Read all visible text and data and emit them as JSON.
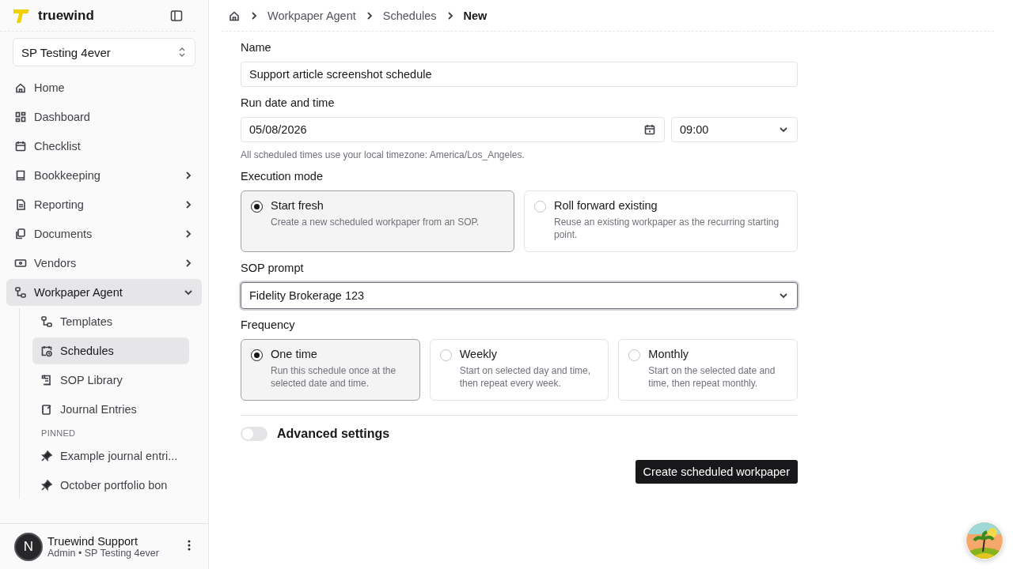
{
  "sidebar": {
    "brand": "truewind",
    "workspace": "SP Testing 4ever",
    "items": [
      {
        "kind": "link",
        "label": "Home",
        "selected": false
      },
      {
        "kind": "link",
        "label": "Dashboard",
        "selected": false
      },
      {
        "kind": "link",
        "label": "Checklist",
        "selected": false
      },
      {
        "kind": "group",
        "label": "Bookkeeping",
        "selected": false,
        "expanded": false
      },
      {
        "kind": "group",
        "label": "Reporting",
        "selected": false,
        "expanded": false
      },
      {
        "kind": "group",
        "label": "Documents",
        "selected": false,
        "expanded": false
      },
      {
        "kind": "group",
        "label": "Vendors",
        "selected": false,
        "expanded": false
      },
      {
        "kind": "group",
        "label": "Workpaper Agent",
        "selected": true,
        "expanded": true,
        "children": [
          {
            "label": "Templates",
            "selected": false
          },
          {
            "label": "Schedules",
            "selected": true
          },
          {
            "label": "SOP Library",
            "selected": false
          },
          {
            "label": "Journal Entries",
            "selected": false
          }
        ]
      }
    ],
    "pinned": {
      "heading": "PINNED",
      "items": [
        "Example journal entri...",
        "October portfolio bon"
      ]
    },
    "user": {
      "initial": "N",
      "name": "Truewind Support",
      "detail": "Admin • SP Testing 4ever"
    }
  },
  "breadcrumb": [
    "Workpaper Agent",
    "Schedules",
    "New"
  ],
  "form": {
    "name": {
      "label": "Name",
      "value": "Support article screenshot schedule"
    },
    "run": {
      "label": "Run date and time",
      "date": "05/08/2026",
      "time": "09:00",
      "hint": "All scheduled times use your local timezone: America/Los_Angeles."
    },
    "execution": {
      "label": "Execution mode",
      "options": [
        {
          "title": "Start fresh",
          "description": "Create a new scheduled workpaper from an SOP.",
          "selected": true
        },
        {
          "title": "Roll forward existing",
          "description": "Reuse an existing workpaper as the recurring starting point.",
          "selected": false
        }
      ]
    },
    "sop": {
      "label": "SOP prompt",
      "value": "Fidelity Brokerage 123"
    },
    "frequency": {
      "label": "Frequency",
      "options": [
        {
          "title": "One time",
          "description": "Run this schedule once at the selected date and time.",
          "selected": true
        },
        {
          "title": "Weekly",
          "description": "Start on selected day and time, then repeat every week.",
          "selected": false
        },
        {
          "title": "Monthly",
          "description": "Start on the selected date and time, then repeat monthly.",
          "selected": false
        }
      ]
    },
    "advanced": {
      "label": "Advanced settings",
      "on": false
    },
    "submit": "Create scheduled workpaper"
  }
}
